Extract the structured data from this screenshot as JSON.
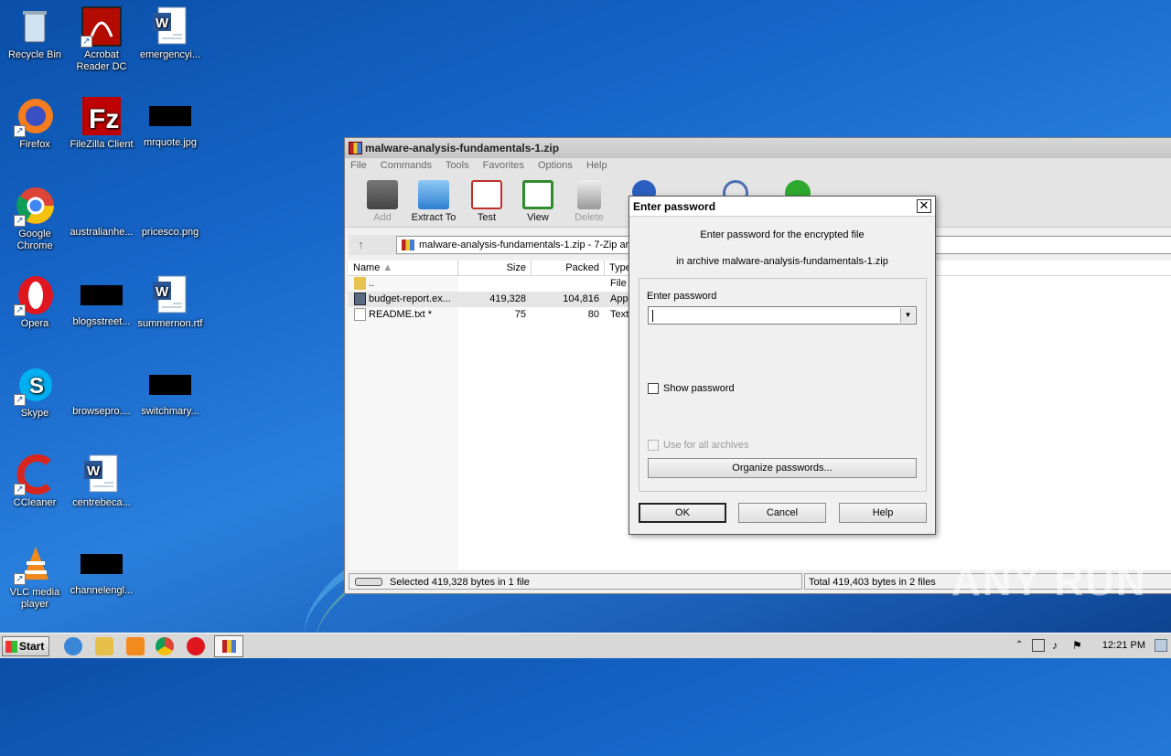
{
  "desktop": {
    "icons": [
      {
        "label": "Recycle Bin"
      },
      {
        "label": "Acrobat Reader DC"
      },
      {
        "label": "emergencyi..."
      },
      {
        "label": "Firefox"
      },
      {
        "label": "FileZilla Client"
      },
      {
        "label": "mrquote.jpg"
      },
      {
        "label": "Google Chrome"
      },
      {
        "label": "australianhe..."
      },
      {
        "label": "pricesco.png"
      },
      {
        "label": "Opera"
      },
      {
        "label": "blogsstreet..."
      },
      {
        "label": "summernon.rtf"
      },
      {
        "label": "Skype"
      },
      {
        "label": "browsepro...."
      },
      {
        "label": "switchmary..."
      },
      {
        "label": "CCleaner"
      },
      {
        "label": "centrebeca..."
      },
      {
        "label": "VLC media player"
      },
      {
        "label": "channelengl..."
      }
    ]
  },
  "window": {
    "title": "malware-analysis-fundamentals-1.zip",
    "menu": [
      "File",
      "Commands",
      "Tools",
      "Favorites",
      "Options",
      "Help"
    ],
    "toolbar": {
      "add": "Add",
      "extract": "Extract To",
      "test": "Test",
      "view": "View",
      "delete": "Delete"
    },
    "address": "malware-analysis-fundamentals-1.zip - 7-Zip archive",
    "columns": {
      "name": "Name",
      "size": "Size",
      "packed": "Packed",
      "type": "Type"
    },
    "files": [
      {
        "name": "..",
        "size": "",
        "packed": "",
        "type": "File f"
      },
      {
        "name": "budget-report.ex...",
        "size": "419,328",
        "packed": "104,816",
        "type": "Appl"
      },
      {
        "name": "README.txt *",
        "size": "75",
        "packed": "80",
        "type": "Text"
      }
    ],
    "status_left": "Selected 419,328 bytes in 1 file",
    "status_right": "Total 419,403 bytes in 2 files"
  },
  "dialog": {
    "title": "Enter password",
    "close": "✕",
    "line1": "Enter password for the encrypted file",
    "line2": "in archive malware-analysis-fundamentals-1.zip",
    "field_label": "Enter password",
    "password_value": "",
    "show_password": "Show password",
    "use_all": "Use for all archives",
    "organize": "Organize passwords...",
    "ok": "OK",
    "cancel": "Cancel",
    "help": "Help"
  },
  "taskbar": {
    "start": "Start",
    "clock": "12:21 PM"
  },
  "watermark": "ANY RUN"
}
